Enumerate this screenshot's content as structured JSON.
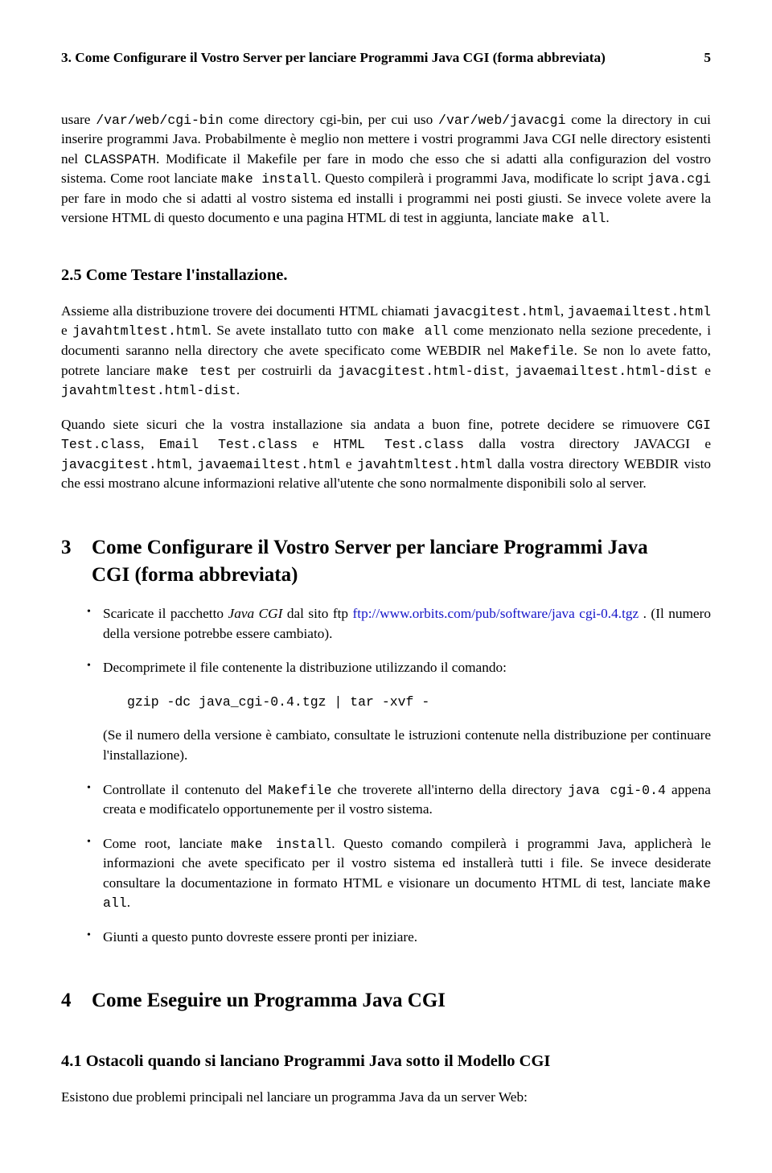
{
  "header": {
    "left": "3.  Come Configurare il Vostro Server per lanciare Programmi Java CGI (forma abbreviata)",
    "right": "5"
  },
  "p1": {
    "t1": "usare ",
    "c1": "/var/web/cgi-bin",
    "t2": " come directory cgi-bin, per cui uso ",
    "c2": "/var/web/javacgi",
    "t3": " come la directory in cui inserire programmi Java. Probabilmente è meglio non mettere i vostri programmi Java CGI nelle directory esistenti nel ",
    "c3": "CLASSPATH",
    "t4": ". Modificate il Makefile per fare in modo che esso che si adatti alla configurazion del vostro sistema. Come root lanciate ",
    "c4": "make install",
    "t5": ". Questo compilerà i programmi Java, modificate lo script ",
    "c5": "java.cgi",
    "t6": " per fare in modo che si adatti al vostro sistema ed installi i programmi nei posti giusti. Se invece volete avere la versione HTML di questo documento e una pagina HTML di test in aggiunta, lanciate ",
    "c6": "make all",
    "t7": "."
  },
  "s25": {
    "title": "2.5    Come Testare l'installazione.",
    "p1": {
      "t1": "Assieme alla distribuzione trovere dei documenti HTML chiamati ",
      "c1": "javacgitest.html",
      "t2": ", ",
      "c2": "javaemailtest.html",
      "t3": " e ",
      "c3": "javahtmltest.html",
      "t4": ". Se avete installato tutto con ",
      "c4": "make all",
      "t5": " come menzionato nella sezione precedente, i documenti saranno nella directory che avete specificato come WEBDIR nel ",
      "c5": "Makefile",
      "t6": ". Se non lo avete fatto, potrete lanciare ",
      "c6": "make test",
      "t7": " per costruirli da ",
      "c7": "javacgitest.html-dist",
      "t8": ", ",
      "c8": "javaemailtest.html-dist",
      "t9": " e ",
      "c9": "javahtmltest.html-dist",
      "t10": "."
    },
    "p2": {
      "t1": "Quando siete sicuri che la vostra installazione sia andata a buon fine, potrete decidere se rimuovere ",
      "c1": "CGI Test.class",
      "t2": ", ",
      "c2": "Email Test.class",
      "t3": " e ",
      "c3": "HTML Test.class",
      "t4": " dalla vostra directory JAVACGI e ",
      "c4": "javacgitest.html",
      "t5": ", ",
      "c5": "javaemailtest.html",
      "t6": " e ",
      "c6": "javahtmltest.html",
      "t7": " dalla vostra directory WEBDIR visto che essi mostrano alcune informazioni relative all'utente che sono normalmente disponibili solo al server."
    }
  },
  "s3": {
    "num": "3",
    "title1": "Come Configurare il Vostro Server per lanciare Programmi Java",
    "title2": "CGI (forma abbreviata)",
    "b1": {
      "t1": "Scaricate il pacchetto ",
      "i1": "Java CGI",
      "t2": " dal sito ftp ",
      "link": "ftp://www.orbits.com/pub/software/java cgi-0.4.tgz",
      "t3": " . (Il numero della versione potrebbe essere cambiato)."
    },
    "b2": {
      "t1": "Decomprimete il file contenente la distribuzione utilizzando il comando:",
      "cmd": "gzip -dc java_cgi-0.4.tgz | tar -xvf -",
      "t2": "(Se il numero della versione è cambiato, consultate le istruzioni contenute nella distribuzione per continuare l'installazione)."
    },
    "b3": {
      "t1": "Controllate il contenuto del ",
      "c1": "Makefile",
      "t2": " che troverete all'interno della directory ",
      "c2": "java cgi-0.4",
      "t3": " appena creata e modificatelo opportunemente per il vostro sistema."
    },
    "b4": {
      "t1": "Come root, lanciate ",
      "c1": "make install",
      "t2": ". Questo comando compilerà i programmi Java, applicherà le informazioni che avete specificato per il vostro sistema ed installerà tutti i file. Se invece desiderate consultare la documentazione in formato HTML e visionare un documento HTML di test, lanciate ",
      "c2": "make all",
      "t3": "."
    },
    "b5": "Giunti a questo punto dovreste essere pronti per iniziare."
  },
  "s4": {
    "num": "4",
    "title": "Come Eseguire un Programma Java CGI",
    "sub": {
      "title": "4.1    Ostacoli quando si lanciano Programmi Java sotto il Modello CGI",
      "p1": "Esistono due problemi principali nel lanciare un programma Java da un server Web:"
    }
  }
}
